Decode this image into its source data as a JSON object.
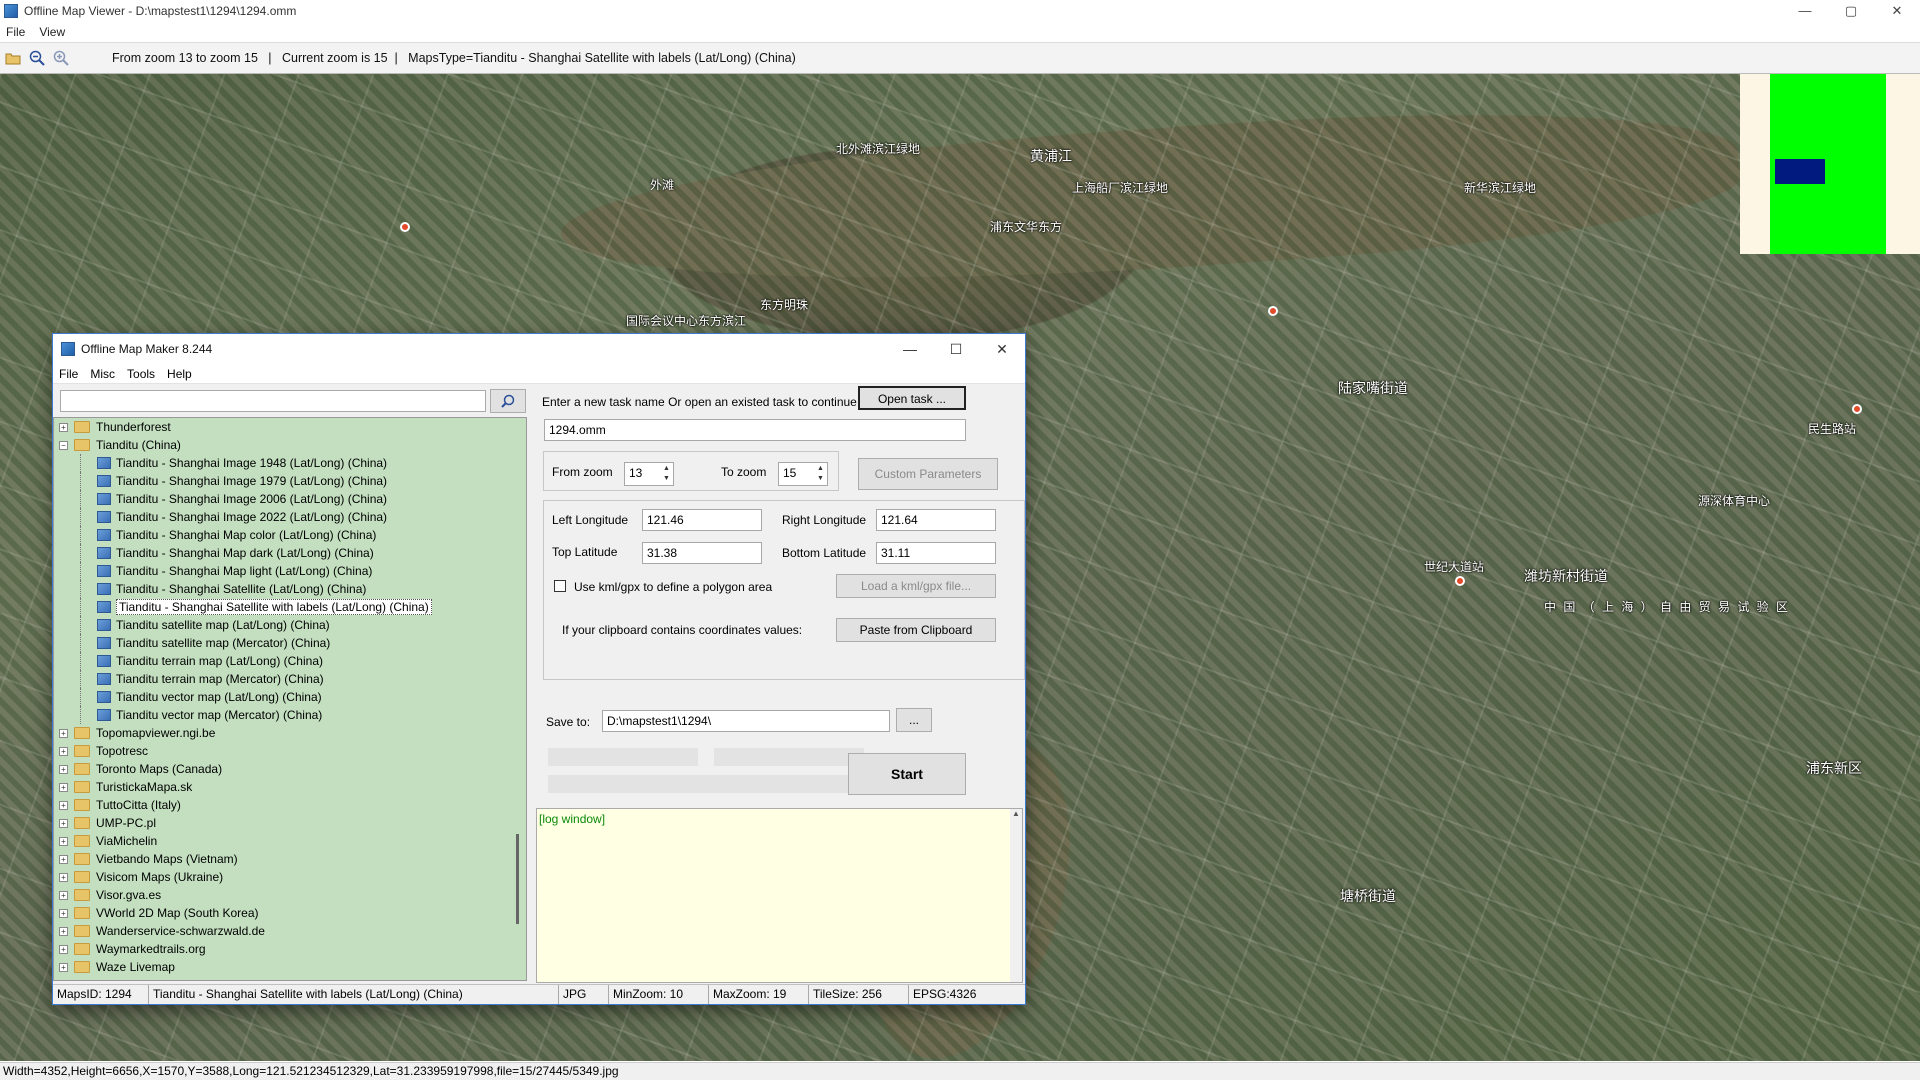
{
  "window": {
    "title": "Offline Map Viewer - D:\\mapstest1\\1294\\1294.omm",
    "minimize": "—",
    "maximize": "▢",
    "close": "✕"
  },
  "menu": [
    "File",
    "View"
  ],
  "toolbar": {
    "info": "From zoom 13 to zoom 15   |   Current zoom is 15  |   MapsType=Tianditu - Shanghai Satellite with labels (Lat/Long) (China)"
  },
  "map_labels": [
    {
      "text": "黄浦江"
    },
    {
      "text": "上海船厂滨江绿地"
    },
    {
      "text": "新华滨江绿地"
    },
    {
      "text": "浦东文华东方"
    },
    {
      "text": "陆家嘴街道"
    },
    {
      "text": "东方明珠"
    },
    {
      "text": "国际会议中心东方滨江"
    },
    {
      "text": "潍坊新村街道"
    },
    {
      "text": "世纪大道站"
    },
    {
      "text": "中 国 （ 上 海 ） 自 由 贸 易 试 验 区"
    },
    {
      "text": "浦东新区"
    },
    {
      "text": "塘桥街道"
    },
    {
      "text": "源深体育中心"
    },
    {
      "text": "民生路站"
    },
    {
      "text": "外滩"
    },
    {
      "text": "北外滩滨江绿地"
    }
  ],
  "status": {
    "text": "Width=4352,Height=6656,X=1570,Y=3588,Long=121.521234512329,Lat=31.233959197998,file=15/27445/5349.jpg"
  },
  "dialog": {
    "title": "Offline Map Maker 8.244",
    "minimize": "—",
    "maximize": "☐",
    "close": "✕",
    "menu": [
      "File",
      "Misc",
      "Tools",
      "Help"
    ],
    "search_value": "",
    "tree": [
      {
        "label": "Thunderforest",
        "level": 0,
        "expander": "+"
      },
      {
        "label": "Tianditu (China)",
        "level": 0,
        "expander": "−"
      },
      {
        "label": "Tianditu - Shanghai Image 1948 (Lat/Long) (China)",
        "level": 1
      },
      {
        "label": "Tianditu - Shanghai Image 1979 (Lat/Long) (China)",
        "level": 1
      },
      {
        "label": "Tianditu - Shanghai Image 2006 (Lat/Long) (China)",
        "level": 1
      },
      {
        "label": "Tianditu - Shanghai Image 2022 (Lat/Long) (China)",
        "level": 1
      },
      {
        "label": "Tianditu - Shanghai Map color (Lat/Long) (China)",
        "level": 1
      },
      {
        "label": "Tianditu - Shanghai Map dark (Lat/Long) (China)",
        "level": 1
      },
      {
        "label": "Tianditu - Shanghai Map light (Lat/Long) (China)",
        "level": 1
      },
      {
        "label": "Tianditu - Shanghai Satellite (Lat/Long) (China)",
        "level": 1
      },
      {
        "label": "Tianditu - Shanghai Satellite with labels (Lat/Long) (China)",
        "level": 1,
        "selected": true
      },
      {
        "label": "Tianditu satellite map (Lat/Long) (China)",
        "level": 1
      },
      {
        "label": "Tianditu satellite map (Mercator) (China)",
        "level": 1
      },
      {
        "label": "Tianditu terrain map (Lat/Long) (China)",
        "level": 1
      },
      {
        "label": "Tianditu terrain map (Mercator) (China)",
        "level": 1
      },
      {
        "label": "Tianditu vector map (Lat/Long) (China)",
        "level": 1
      },
      {
        "label": "Tianditu vector map (Mercator) (China)",
        "level": 1
      },
      {
        "label": "Topomapviewer.ngi.be",
        "level": 0,
        "expander": "+"
      },
      {
        "label": "Topotresc",
        "level": 0,
        "expander": "+"
      },
      {
        "label": "Toronto Maps (Canada)",
        "level": 0,
        "expander": "+"
      },
      {
        "label": "TuristickaMapa.sk",
        "level": 0,
        "expander": "+"
      },
      {
        "label": "TuttoCitta (Italy)",
        "level": 0,
        "expander": "+"
      },
      {
        "label": "UMP-PC.pl",
        "level": 0,
        "expander": "+"
      },
      {
        "label": "ViaMichelin",
        "level": 0,
        "expander": "+"
      },
      {
        "label": "Vietbando Maps (Vietnam)",
        "level": 0,
        "expander": "+"
      },
      {
        "label": "Visicom Maps (Ukraine)",
        "level": 0,
        "expander": "+"
      },
      {
        "label": "Visor.gva.es",
        "level": 0,
        "expander": "+"
      },
      {
        "label": "VWorld 2D Map (South Korea)",
        "level": 0,
        "expander": "+"
      },
      {
        "label": "Wanderservice-schwarzwald.de",
        "level": 0,
        "expander": "+"
      },
      {
        "label": "Waymarkedtrails.org",
        "level": 0,
        "expander": "+"
      },
      {
        "label": "Waze Livemap",
        "level": 0,
        "expander": "+"
      }
    ],
    "task_prompt": "Enter a new task name Or open an existed task to continue:",
    "open_task_label": "Open task ...",
    "task_name": "1294.omm",
    "from_zoom_label": "From zoom",
    "from_zoom_value": "13",
    "to_zoom_label": "To zoom",
    "to_zoom_value": "15",
    "custom_params_label": "Custom Parameters",
    "left_lon_label": "Left Longitude",
    "left_lon_value": "121.46",
    "right_lon_label": "Right Longitude",
    "right_lon_value": "121.64",
    "top_lat_label": "Top Latitude",
    "top_lat_value": "31.38",
    "bottom_lat_label": "Bottom Latitude",
    "bottom_lat_value": "31.11",
    "kml_label": "Use kml/gpx to define a polygon area",
    "load_kml_label": "Load a kml/gpx file...",
    "clipboard_prompt": "If your clipboard contains coordinates values:",
    "paste_clipboard_label": "Paste from Clipboard",
    "save_to_label": "Save to:",
    "save_to_value": "D:\\mapstest1\\1294\\",
    "browse_label": "...",
    "start_label": "Start",
    "log_text": "[log window]",
    "status": {
      "maps_id": "MapsID: 1294",
      "maps_name": "Tianditu - Shanghai Satellite with labels (Lat/Long) (China)",
      "format": "JPG",
      "min_zoom": "MinZoom: 10",
      "max_zoom": "MaxZoom: 19",
      "tile_size": "TileSize: 256",
      "epsg": "EPSG:4326"
    }
  }
}
